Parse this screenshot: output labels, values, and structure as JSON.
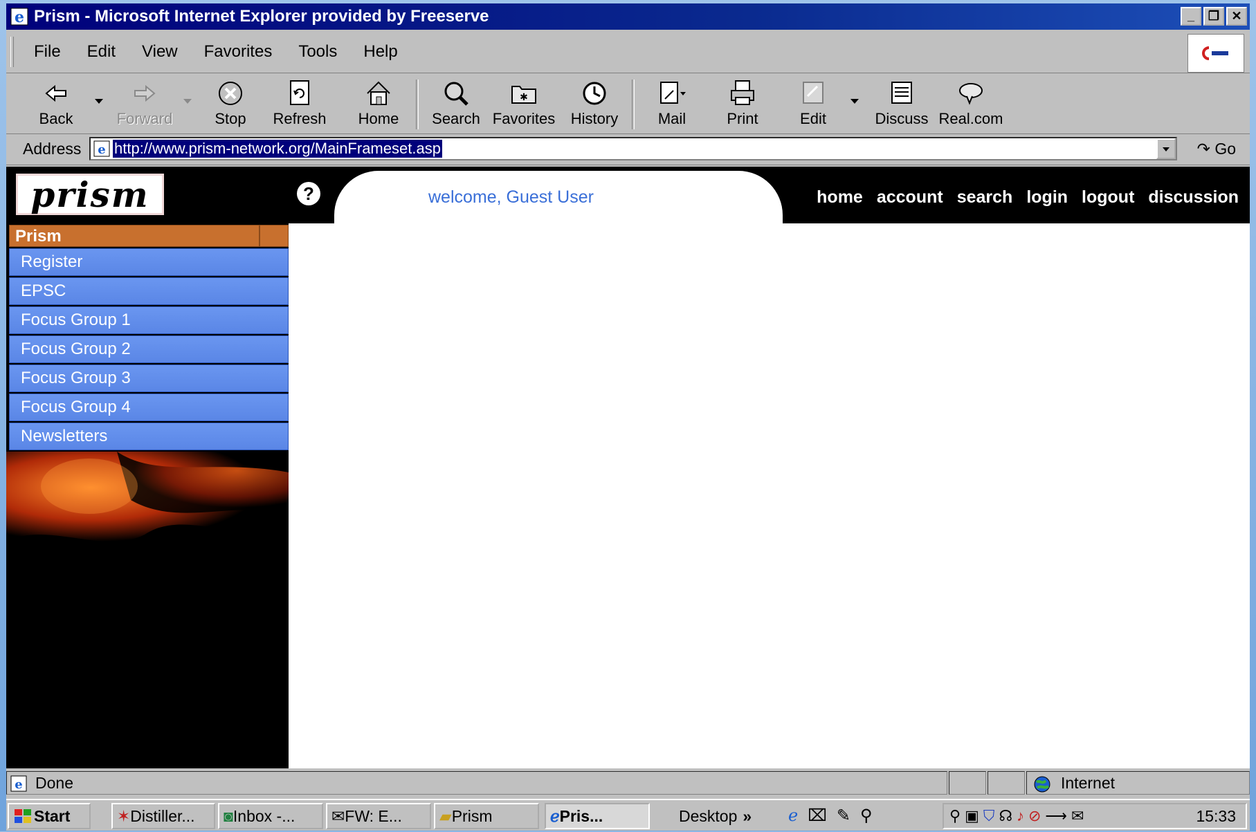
{
  "window": {
    "title": "Prism - Microsoft Internet Explorer provided by Freeserve"
  },
  "menu": [
    "File",
    "Edit",
    "View",
    "Favorites",
    "Tools",
    "Help"
  ],
  "toolbar": {
    "back": "Back",
    "forward": "Forward",
    "stop": "Stop",
    "refresh": "Refresh",
    "home": "Home",
    "search": "Search",
    "favorites": "Favorites",
    "history": "History",
    "mail": "Mail",
    "print": "Print",
    "edit": "Edit",
    "discuss": "Discuss",
    "realcom": "Real.com"
  },
  "address": {
    "label": "Address",
    "url": "http://www.prism-network.org/MainFrameset.asp",
    "go": "Go"
  },
  "page": {
    "logo": "prism",
    "welcome": "welcome, Guest User",
    "nav": [
      "home",
      "account",
      "search",
      "login",
      "logout",
      "discussion"
    ],
    "sidebar": {
      "title": "Prism",
      "items": [
        "Register",
        "EPSC",
        "Focus Group 1",
        "Focus Group 2",
        "Focus Group 3",
        "Focus Group 4",
        "Newsletters"
      ]
    }
  },
  "status": {
    "text": "Done",
    "zone": "Internet"
  },
  "taskbar": {
    "start": "Start",
    "buttons": [
      "Distiller...",
      "Inbox -...",
      "FW: E...",
      "Prism",
      "Pris..."
    ],
    "desktop": "Desktop",
    "clock": "15:33"
  },
  "colors": {
    "title_bar": "#00007b",
    "sidebar_item": "#5a86e6",
    "sidebar_header": "#c8702e",
    "welcome_text": "#3a6fd8"
  }
}
